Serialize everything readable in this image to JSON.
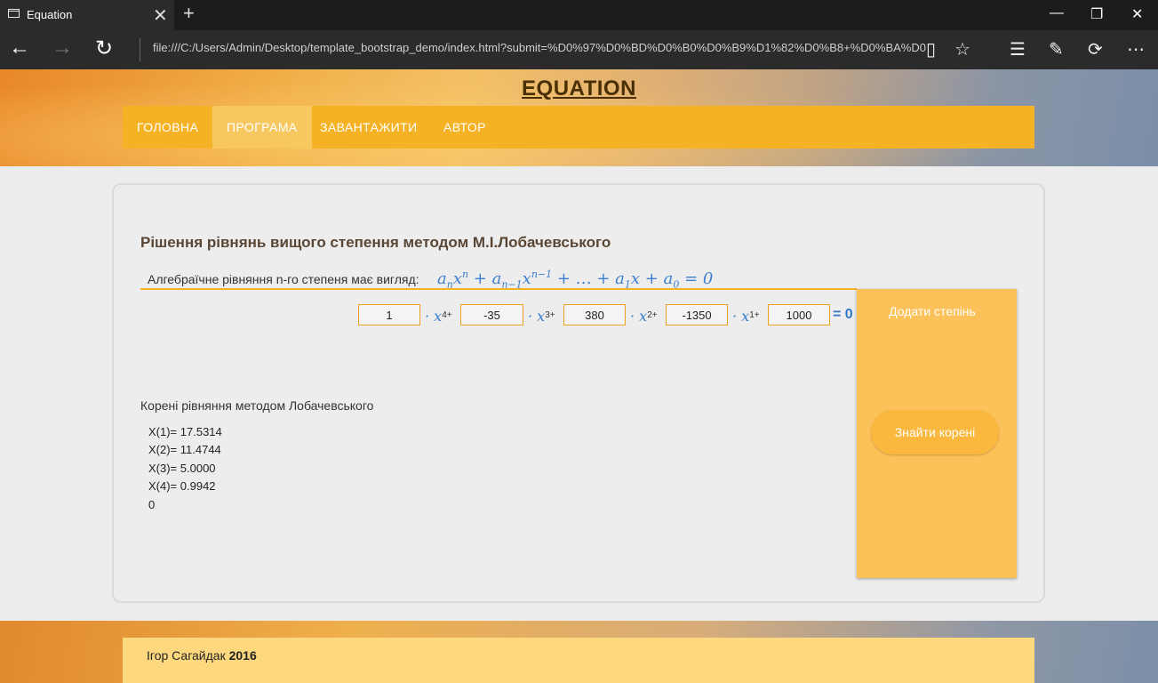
{
  "browser": {
    "tab_title": "Equation",
    "tab_close": "✕",
    "new_tab": "+",
    "address": "file:///C:/Users/Admin/Desktop/template_bootstrap_demo/index.html?submit=%D0%97%D0%BD%D0%B0%D0%B9%D1%82%D0%B8+%D0%BA%D0",
    "window_controls": {
      "minimize": "—",
      "restore": "❐",
      "close": "✕"
    },
    "nav": {
      "back": "←",
      "forward": "→",
      "refresh": "↻"
    },
    "toolbar_icons": [
      "reading-view-icon",
      "favorite-star-icon",
      "hub-icon",
      "web-note-icon",
      "share-icon",
      "more-icon"
    ]
  },
  "site": {
    "title": "EQUATION",
    "menu": [
      "ГОЛОВНА",
      "ПРОГРАМА",
      "ЗАВАНТАЖИТИ",
      "АВТОР"
    ],
    "active_menu": "ПРОГРАМА"
  },
  "main": {
    "heading": "Рішення рівнянь вищого степення методом М.І.Лобачевського",
    "intro": "Алгебраїчне рівняння n-го степеня має вигляд:",
    "coefficients": [
      "1",
      "-35",
      "380",
      "-1350",
      "1000"
    ],
    "powers": [
      "4",
      "3",
      "2",
      "1"
    ],
    "equals_zero": "= 0",
    "add_power_label": "Додати степінь",
    "find_roots_label": "Знайти корені",
    "roots_title": "Корені рівняння методом Лобачевського",
    "roots": [
      "X(1)= 17.5314",
      "X(2)= 11.4744",
      "X(3)= 5.0000",
      "X(4)= 0.9942",
      "0"
    ]
  },
  "footer": {
    "author": "Ігор Сагайдак",
    "year": "2016"
  },
  "colors": {
    "menu_bg": "#f4b224",
    "menu_active": "#f8c860",
    "panel": "#fdc15a",
    "formula": "#3a7fd0"
  }
}
